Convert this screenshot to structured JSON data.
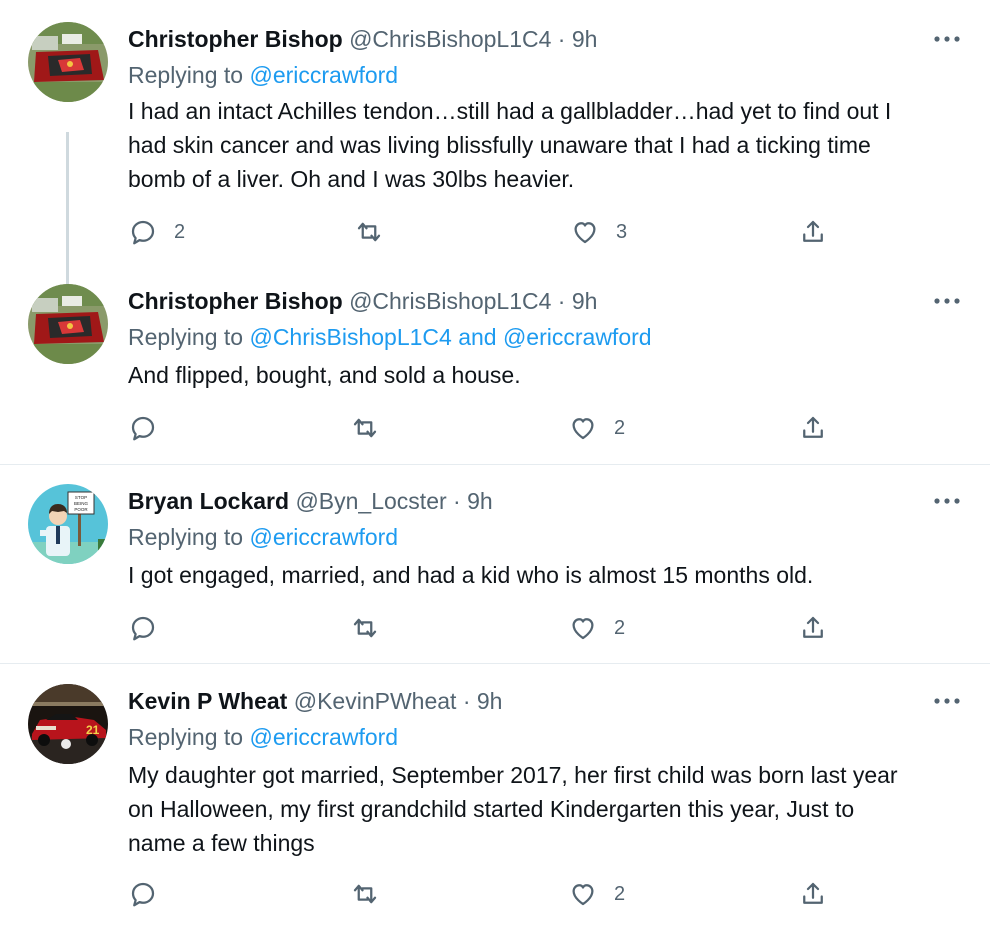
{
  "tweets": [
    {
      "name": "Christopher Bishop",
      "handle": "@ChrisBishopL1C4",
      "separator": "·",
      "time": "9h",
      "replying_prefix": "Replying to",
      "mentions": [
        "@ericcrawford"
      ],
      "mention_joiner": "",
      "body_lines": [
        "I had an intact Achilles tendon…still had a gallbladder…had yet to find out I",
        "had skin cancer and was living blissfully unaware that I had a ticking time",
        "bomb of a liver. Oh and I was 30lbs heavier."
      ],
      "counts": {
        "reply": "2",
        "retweet": "",
        "like": "3"
      },
      "avatar": "cardinals-lawn-avatar"
    },
    {
      "name": "Christopher Bishop",
      "handle": "@ChrisBishopL1C4",
      "separator": "·",
      "time": "9h",
      "replying_prefix": "Replying to",
      "mentions": [
        "@ChrisBishopL1C4",
        "@ericcrawford"
      ],
      "mention_joiner": "and",
      "body_lines": [
        "And flipped, bought, and sold a house."
      ],
      "counts": {
        "reply": "",
        "retweet": "",
        "like": "2"
      },
      "avatar": "cardinals-lawn-avatar"
    },
    {
      "name": "Bryan Lockard",
      "handle": "@Byn_Locster",
      "separator": "·",
      "time": "9h",
      "replying_prefix": "Replying to",
      "mentions": [
        "@ericcrawford"
      ],
      "mention_joiner": "",
      "body_lines": [
        "I got engaged, married, and had a kid who is almost 15 months old."
      ],
      "counts": {
        "reply": "",
        "retweet": "",
        "like": "2"
      },
      "avatar": "cartoon-sign-avatar",
      "avatar_sign": "STOP BEING POOR"
    },
    {
      "name": "Kevin P Wheat",
      "handle": "@KevinPWheat",
      "separator": "·",
      "time": "9h",
      "replying_prefix": "Replying to",
      "mentions": [
        "@ericcrawford"
      ],
      "mention_joiner": "",
      "body_lines": [
        "My daughter got married, September 2017, her first child  was born last year",
        "on Halloween, my first grandchild started Kindergarten this year, Just to",
        "name a few things"
      ],
      "counts": {
        "reply": "",
        "retweet": "",
        "like": "2"
      },
      "avatar": "race-car-avatar",
      "avatar_number": "21"
    }
  ],
  "colors": {
    "text": "#0f1419",
    "secondary": "#536471",
    "link": "#1d9bf0",
    "divider": "#e6ecf0",
    "thread_line": "#cfd9de"
  },
  "icons": {
    "reply": "reply-icon",
    "retweet": "retweet-icon",
    "like": "like-icon",
    "share": "share-icon",
    "more": "more-icon"
  }
}
